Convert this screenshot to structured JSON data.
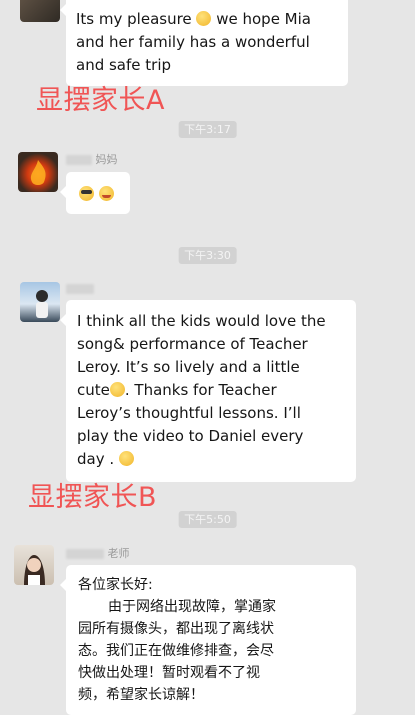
{
  "messages": {
    "m1": {
      "lines": [
        "Its my pleasure",
        " we hope Mia",
        "and her family has a wonderful",
        "and safe trip"
      ]
    },
    "time1": "下午3:17",
    "m2": {
      "sender_suffix": "妈妈"
    },
    "time2": "下午3:30",
    "m3": {
      "lines": [
        "I think all the kids would love the",
        "song& performance of Teacher",
        "Leroy. It’s so lively and a little",
        "cute",
        ". Thanks for Teacher",
        "Leroy’s thoughtful lessons. I’ll",
        "play the video to Daniel every",
        "day ."
      ]
    },
    "time3": "下午5:50",
    "m4": {
      "sender_suffix": "老师",
      "lines": [
        "各位家长好:",
        "由于网络出现故障，掌通家",
        "园所有摄像头，都出现了离线状",
        "态。我们正在做维修排查，会尽",
        "快做出处理！暂时观看不了视",
        "频，希望家长谅解！"
      ]
    }
  },
  "overlays": {
    "a": "显摆家长A",
    "b": "显摆家长B"
  },
  "icons": [
    "avatar-top",
    "avatar-fire",
    "avatar-girl",
    "avatar-woman",
    "sunglasses-emoji",
    "smile-emoji"
  ]
}
